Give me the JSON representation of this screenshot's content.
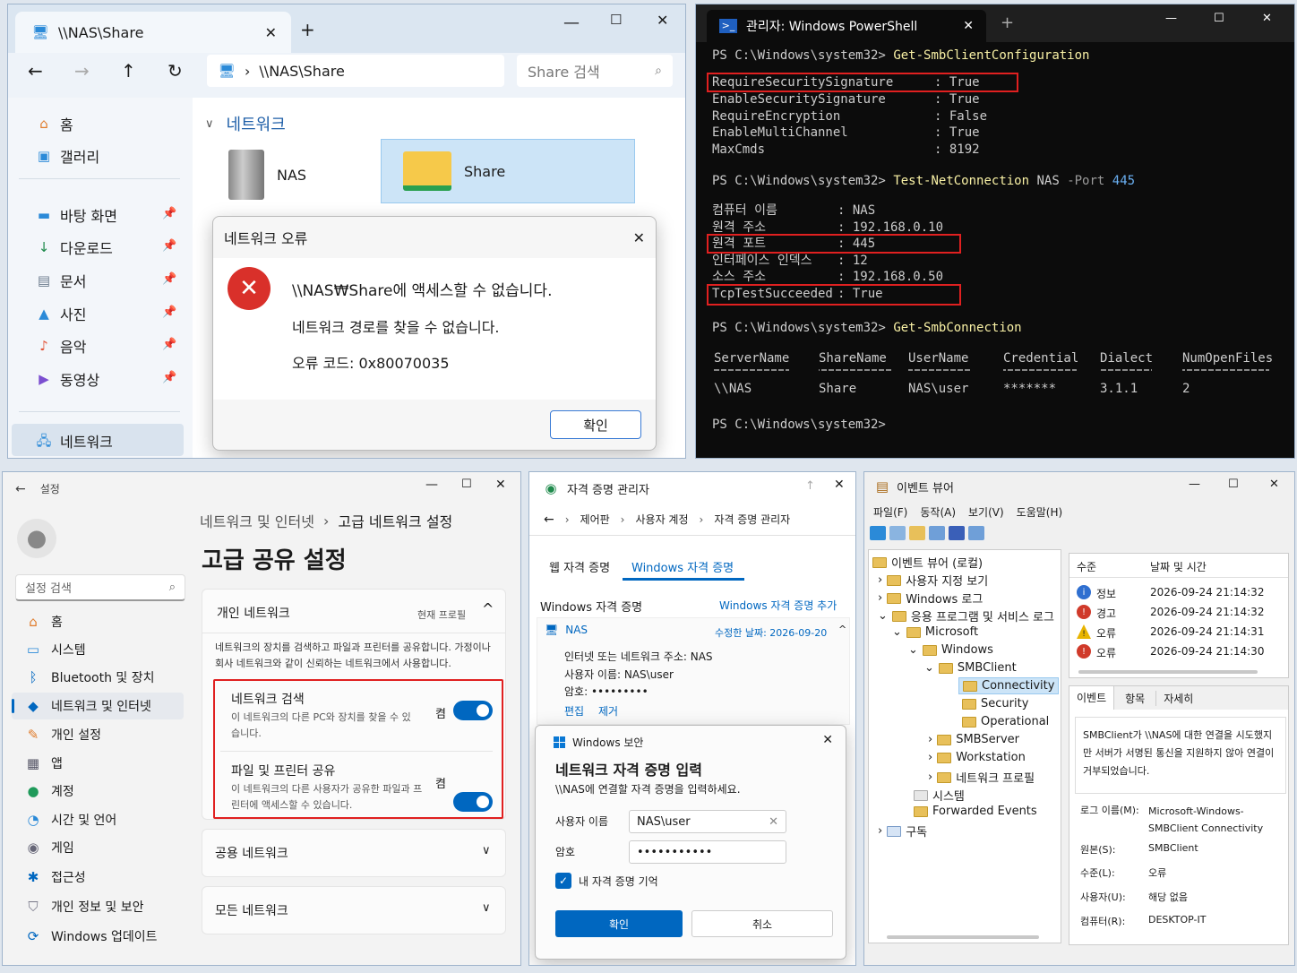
{
  "explorer": {
    "tab_title": "\\\\NAS\\Share",
    "address": "\\\\NAS\\Share",
    "search_placeholder": "Share 검색",
    "nav": {
      "home": "홈",
      "gallery": "갤러리",
      "desktop": "바탕 화면",
      "downloads": "다운로드",
      "documents": "문서",
      "pictures": "사진",
      "music": "음악",
      "videos": "동영상",
      "network": "네트워크"
    },
    "section": "네트워크",
    "items": [
      "NAS",
      "Share"
    ],
    "dialog": {
      "title": "네트워크 오류",
      "message": "\\\\NAS₩Share에 액세스할 수 없습니다.",
      "detail": "네트워크 경로를 찾을 수 없습니다.",
      "code": "오류 코드: 0x80070035",
      "ok": "확인"
    }
  },
  "powershell": {
    "tab_title": "관리자: Windows PowerShell",
    "prompt": "PS C:\\Windows\\system32>",
    "cmd1": "Get-SmbClientConfiguration",
    "config": [
      {
        "key": "RequireSecuritySignature",
        "value": "True"
      },
      {
        "key": "EnableSecuritySignature",
        "value": "True"
      },
      {
        "key": "RequireEncryption",
        "value": "False"
      },
      {
        "key": "EnableMultiChannel",
        "value": "True"
      },
      {
        "key": "MaxCmds",
        "value": "8192"
      }
    ],
    "cmd2": "Test-NetConnection",
    "cmd2_arg": "NAS",
    "cmd2_param": "-Port",
    "cmd2_port": "445",
    "netconn": [
      {
        "key": "컴퓨터 이름",
        "value": "NAS"
      },
      {
        "key": "원격 주소",
        "value": "192.168.0.10"
      },
      {
        "key": "원격 포트",
        "value": "445"
      },
      {
        "key": "인터페이스 인덱스",
        "value": "12"
      },
      {
        "key": "소스 주소",
        "value": "192.168.0.50"
      },
      {
        "key": "TcpTestSucceeded",
        "value": "True"
      }
    ],
    "cmd3": "Get-SmbConnection",
    "table_headers": [
      "ServerName",
      "ShareName",
      "UserName",
      "Credential",
      "Dialect",
      "NumOpenFiles"
    ],
    "table_row": [
      "\\\\NAS",
      "Share",
      "NAS\\user",
      "*******",
      "3.1.1",
      "2"
    ]
  },
  "settings": {
    "title": "설정",
    "search_placeholder": "설정 검색",
    "nav": [
      "홈",
      "시스템",
      "Bluetooth 및 장치",
      "네트워크 및 인터넷",
      "개인 설정",
      "앱",
      "계정",
      "시간 및 언어",
      "게임",
      "접근성",
      "개인 정보 및 보안",
      "Windows 업데이트"
    ],
    "breadcrumb_parent": "네트워크 및 인터넷",
    "breadcrumb_current": "고급 네트워크 설정",
    "page_title": "고급 공유 설정",
    "private": {
      "title": "개인 네트워크",
      "badge": "현재 프로필",
      "desc": "네트워크의 장치를 검색하고 파일과 프린터를 공유합니다. 가정이나 회사 네트워크와 같이 신뢰하는 네트워크에서 사용합니다.",
      "discovery_title": "네트워크 검색",
      "discovery_desc": "이 네트워크의 다른 PC와 장치를 찾을 수 있습니다.",
      "discovery_state": "켬",
      "share_title": "파일 및 프린터 공유",
      "share_desc": "이 네트워크의 다른 사용자가 공유한 파일과 프린터에 액세스할 수 있습니다.",
      "share_state": "켬"
    },
    "public": "공용 네트워크",
    "all": "모든 네트워크"
  },
  "cred": {
    "title": "자격 증명 관리자",
    "breadcrumb": [
      "제어판",
      "사용자 계정",
      "자격 증명 관리자"
    ],
    "tab_web": "웹 자격 증명",
    "tab_windows": "Windows 자격 증명",
    "section": "Windows 자격 증명",
    "add": "Windows 자격 증명 추가",
    "entry_name": "NAS",
    "entry_modified": "수정한 날짜: 2026-09-20",
    "entry_address": "인터넷 또는 네트워크 주소: NAS",
    "entry_user": "사용자 이름: NAS\\user",
    "entry_pass": "암호: •••••••••",
    "edit": "편집",
    "remove": "제거",
    "dialog": {
      "app": "Windows 보안",
      "title": "네트워크 자격 증명 입력",
      "subtitle": "\\\\NAS에 연결할 자격 증명을 입력하세요.",
      "user_label": "사용자 이름",
      "user_value": "NAS\\user",
      "pass_label": "암호",
      "pass_value": "•••••••••••",
      "remember": "내 자격 증명 기억",
      "ok": "확인",
      "cancel": "취소"
    }
  },
  "eventviewer": {
    "title": "이벤트 뷰어",
    "menu": [
      "파일(F)",
      "동작(A)",
      "보기(V)",
      "도움말(H)"
    ],
    "tree": {
      "root": "이벤트 뷰어 (로컬)",
      "custom": "사용자 지정 보기",
      "winlogs": "Windows 로그",
      "applogs": "응용 프로그램 및 서비스 로그",
      "microsoft": "Microsoft",
      "windows": "Windows",
      "smbclient": "SMBClient",
      "connectivity": "Connectivity",
      "security": "Security",
      "operational": "Operational",
      "smbserver": "SMBServer",
      "workstation": "Workstation",
      "netprofile": "네트워크 프로필",
      "system": "시스템",
      "forwarded": "Forwarded Events",
      "subscriptions": "구독"
    },
    "list_headers": [
      "수준",
      "날짜 및 시간"
    ],
    "events": [
      {
        "level": "정보",
        "time": "2026-09-24 21:14:32",
        "color": "#2f6fd0",
        "glyph": "i"
      },
      {
        "level": "경고",
        "time": "2026-09-24 21:14:32",
        "color": "#d03a2a",
        "glyph": "!"
      },
      {
        "level": "오류",
        "time": "2026-09-24 21:14:31",
        "color": "#e8b400",
        "glyph": "!"
      },
      {
        "level": "오류",
        "time": "2026-09-24 21:14:30",
        "color": "#d03a2a",
        "glyph": "!"
      }
    ],
    "tabs": [
      "이벤트",
      "항목",
      "자세히"
    ],
    "message": "SMBClient가 \\\\NAS에 대한 연결을 시도했지만 서버가 서명된 통신을 지원하지 않아 연결이 거부되었습니다.",
    "details": [
      {
        "label": "로그 이름(M):",
        "value": "Microsoft-Windows-SMBClient Connectivity"
      },
      {
        "label": "원본(S):",
        "value": "SMBClient"
      },
      {
        "label": "수준(L):",
        "value": "오류"
      },
      {
        "label": "사용자(U):",
        "value": "해당 없음"
      },
      {
        "label": "컴퓨터(R):",
        "value": "DESKTOP-IT"
      }
    ]
  }
}
